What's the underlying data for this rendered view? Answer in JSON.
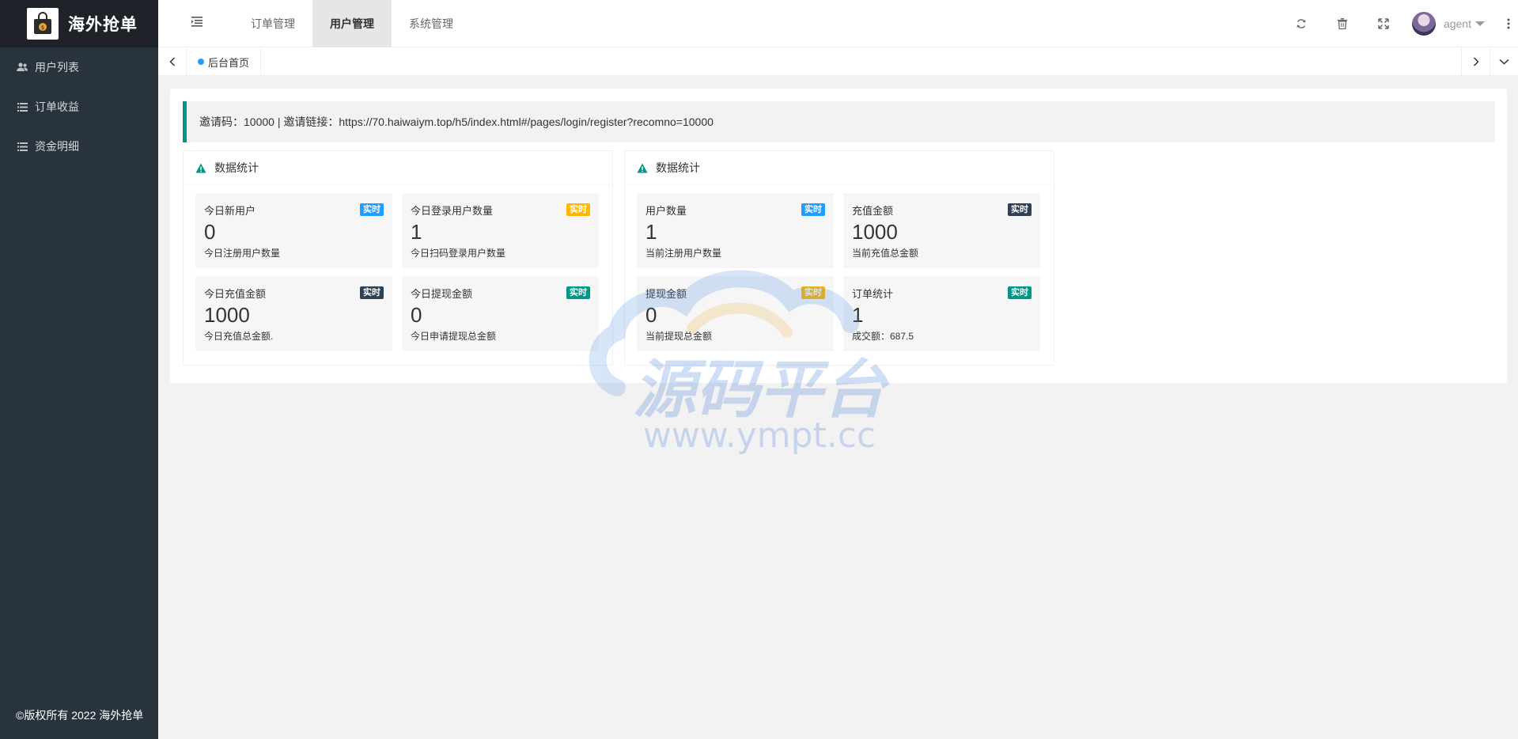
{
  "sidebar": {
    "title": "海外抢单",
    "items": [
      {
        "label": "用户列表",
        "icon": "users-icon"
      },
      {
        "label": "订单收益",
        "icon": "list-icon"
      },
      {
        "label": "资金明细",
        "icon": "list-icon"
      }
    ],
    "copyright": "©版权所有 2022 海外抢单"
  },
  "header": {
    "tabs": [
      {
        "label": "订单管理"
      },
      {
        "label": "用户管理",
        "active": true
      },
      {
        "label": "系统管理"
      }
    ],
    "user": "agent"
  },
  "page_tabs": [
    {
      "label": "后台首页"
    }
  ],
  "invite": {
    "text": "邀请码：10000 | 邀请链接：https://70.haiwaiym.top/h5/index.html#/pages/login/register?recomno=10000"
  },
  "cards": [
    {
      "title": "数据统计",
      "stats": [
        {
          "title": "今日新用户",
          "badge": "实时",
          "badge_color": "#1e9fff",
          "value": "0",
          "desc": "今日注册用户数量"
        },
        {
          "title": "今日登录用户数量",
          "badge": "实时",
          "badge_color": "#ffb800",
          "value": "1",
          "desc": "今日扫码登录用户数量"
        },
        {
          "title": "今日充值金额",
          "badge": "实时",
          "badge_color": "#2f4056",
          "value": "1000",
          "desc": "今日充值总金额."
        },
        {
          "title": "今日提现金额",
          "badge": "实时",
          "badge_color": "#009688",
          "value": "0",
          "desc": "今日申请提现总金额"
        }
      ]
    },
    {
      "title": "数据统计",
      "stats": [
        {
          "title": "用户数量",
          "badge": "实时",
          "badge_color": "#1e9fff",
          "value": "1",
          "desc": "当前注册用户数量"
        },
        {
          "title": "充值金额",
          "badge": "实时",
          "badge_color": "#2f4056",
          "value": "1000",
          "desc": "当前充值总金额"
        },
        {
          "title": "提现金额",
          "badge": "实时",
          "badge_color": "#ffb800",
          "value": "0",
          "desc": "当前提现总金额"
        },
        {
          "title": "订单统计",
          "badge": "实时",
          "badge_color": "#009688",
          "value": "1",
          "desc": "成交额：687.5"
        }
      ]
    }
  ],
  "watermark": {
    "title": "源码平台",
    "url": "www.ympt.cc"
  },
  "colors": {
    "sidebar_bg": "#28333e",
    "logo_bg": "#20222a",
    "accent_green": "#009688",
    "accent_blue": "#1e9fff",
    "accent_orange": "#ffb800",
    "accent_dark": "#2f4056"
  }
}
